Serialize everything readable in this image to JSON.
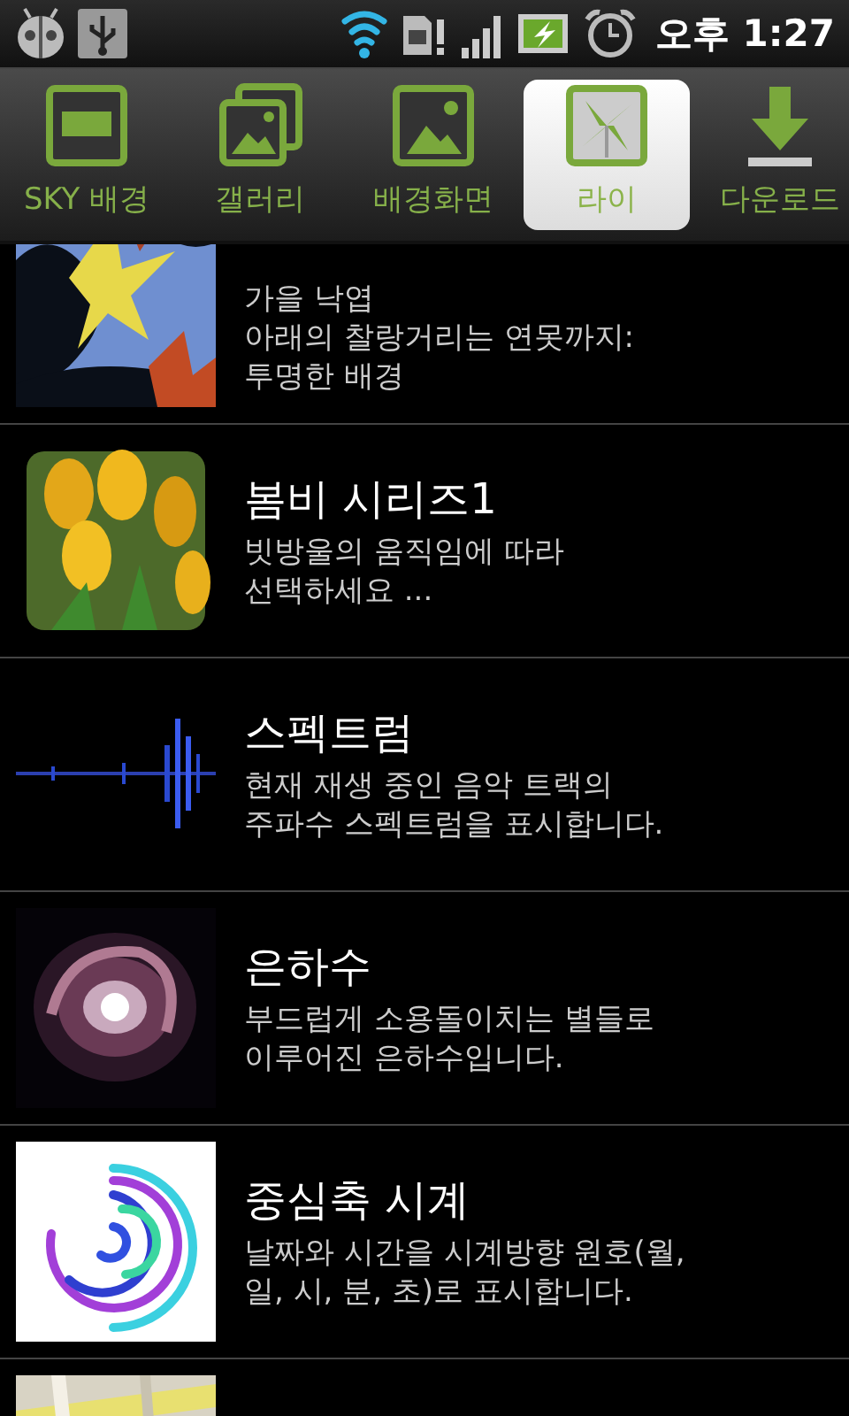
{
  "status_bar": {
    "time": "오후 1:27"
  },
  "tabs": [
    {
      "label": "SKY 배경",
      "selected": false
    },
    {
      "label": "갤러리",
      "selected": false
    },
    {
      "label": "배경화면",
      "selected": false
    },
    {
      "label": "라이",
      "selected": true
    },
    {
      "label": "다운로드",
      "selected": false
    }
  ],
  "items": [
    {
      "kind": "picture",
      "description": "가을 낙엽\n아래의 찰랑거리는 연못까지:\n투명한 배경"
    },
    {
      "kind": "picture",
      "title": "봄비 시리즈1",
      "description": "빗방울의 움직임에 따라\n선택하세요 ..."
    },
    {
      "kind": "picture",
      "title": "스펙트럼",
      "description": "현재 재생 중인 음악 트랙의\n주파수 스펙트럼을 표시합니다."
    },
    {
      "kind": "picture",
      "title": "은하수",
      "description": "부드럽게 소용돌이치는 별들로\n이루어진 은하수입니다."
    },
    {
      "kind": "picture",
      "title": "중심축 시계",
      "description": "날짜와 시간을 시계방향 원호(월,\n일, 시, 분, 초)로 표시합니다."
    },
    {
      "kind": "picture"
    }
  ]
}
